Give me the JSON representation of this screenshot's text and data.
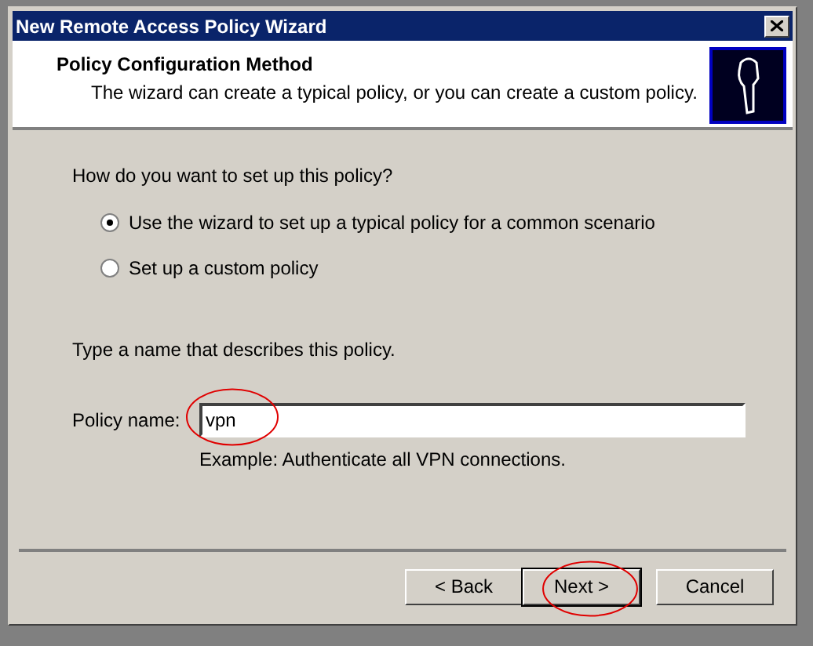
{
  "window": {
    "title": "New Remote Access Policy Wizard"
  },
  "header": {
    "title": "Policy Configuration Method",
    "subtitle": "The wizard can create a typical policy, or you can create a custom policy."
  },
  "question": "How do you want to set up this policy?",
  "options": [
    {
      "label": "Use the wizard to set up a typical policy for a common scenario",
      "selected": true
    },
    {
      "label": "Set up a custom policy",
      "selected": false
    }
  ],
  "name_prompt": "Type a name that describes this policy.",
  "policy_name": {
    "label": "Policy name:",
    "value": "vpn",
    "example": "Example: Authenticate all VPN connections."
  },
  "buttons": [
    {
      "label": "< Back",
      "default": false
    },
    {
      "label": "Next >",
      "default": true
    },
    {
      "label": "Cancel",
      "default": false
    }
  ]
}
